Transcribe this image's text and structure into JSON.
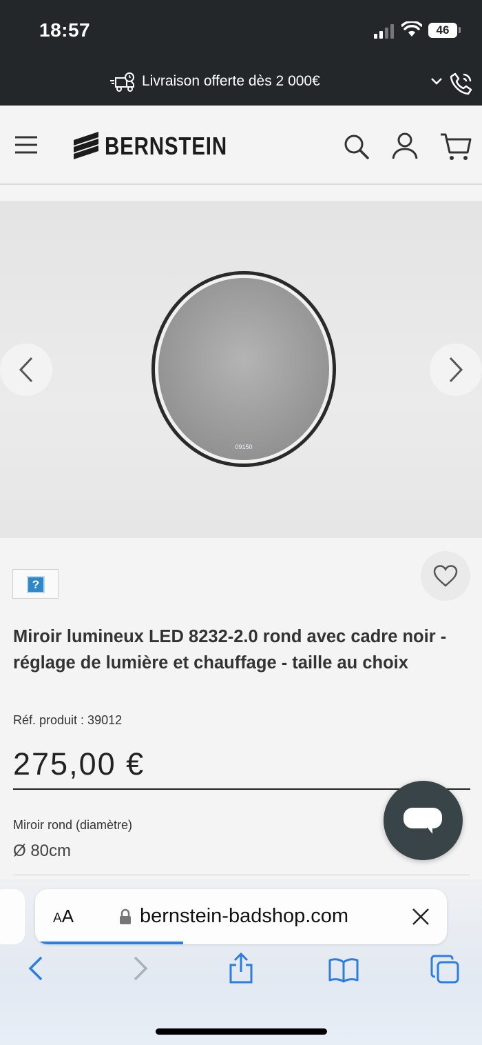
{
  "status_bar": {
    "time": "18:57",
    "battery": "46"
  },
  "promo": {
    "text": "Livraison offerte dès 2 000€"
  },
  "header": {
    "brand": "BERNSTEIN"
  },
  "gallery": {
    "mirror_display_text": "09150"
  },
  "product": {
    "thumb_glyph": "?",
    "title": "Miroir lumineux LED 8232-2.0 rond avec cadre noir - réglage de lumière et chauffage - taille au choix",
    "reference": "Réf. produit : 39012",
    "price": "275,00 €",
    "variant_label": "Miroir rond (diamètre)",
    "variant_value": "Ø 80cm"
  },
  "browser": {
    "aa_label_small": "A",
    "aa_label_large": "A",
    "url": "bernstein-badshop.com",
    "load_progress": 0.36
  },
  "colors": {
    "dark_bar": "#23272a",
    "chat_button": "#394449",
    "safari_blue": "#2a7de1"
  }
}
